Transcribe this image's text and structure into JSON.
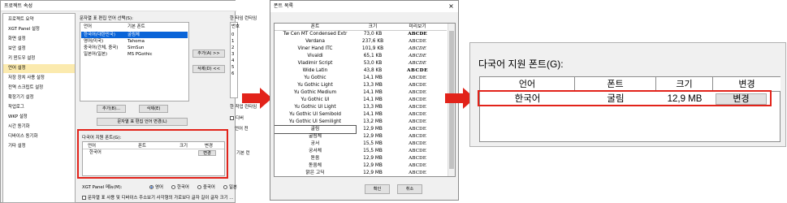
{
  "project_props": {
    "title": "프로젝트 속성",
    "nav_items": [
      {
        "label": "프로젝트 요약"
      },
      {
        "label": "XGT Panel 설정"
      },
      {
        "label": "화면 설정"
      },
      {
        "label": "보안 설정"
      },
      {
        "label": "키 윈도우 설정"
      },
      {
        "label": "언어 설정",
        "selected": true
      },
      {
        "label": "저장 장치 사용 설정"
      },
      {
        "label": "전역 스크립트 설정"
      },
      {
        "label": "확장기기 설정"
      },
      {
        "label": "작업로그"
      },
      {
        "label": "WKP 설정"
      },
      {
        "label": "시간 동기화"
      },
      {
        "label": "디바이스 동기화"
      },
      {
        "label": "기타 설정"
      }
    ],
    "lang_list_label": "문자열 표 편집 언어 선택(S):",
    "lang_columns": [
      "언어",
      "기본 폰트"
    ],
    "lang_rows": [
      {
        "lang": "한국어(대한민국)",
        "font": "굴림체",
        "selected": true
      },
      {
        "lang": "영어(미국)",
        "font": "Tahoma"
      },
      {
        "lang": "중국어(간체, 중국)",
        "font": "SimSun"
      },
      {
        "lang": "일본어(일본)",
        "font": "MS PGothic"
      }
    ],
    "add_btn": "추가(A) >>",
    "delete_btn": "삭제(D) <<",
    "add_btn2": "추가(B)...",
    "delete_btn2": "삭제(E)",
    "change_lang_btn": "문자열 표 편집 언어 변경(L)",
    "right_label1": "한 타임 런타임",
    "right_label_num": "번호",
    "right_nums": [
      "0",
      "1",
      "2",
      "3",
      "4",
      "5",
      "6"
    ],
    "right_label2": "한 작업 런타임",
    "right_chk": "디버",
    "right_label3": "언어 전",
    "right_label4": "기본 런",
    "multi_font_label": "다국어 지원 폰트(G):",
    "multi_font_columns": [
      "언어",
      "폰트",
      "크기",
      "변경"
    ],
    "multi_font_row": {
      "lang": "한국어",
      "font": "",
      "size": "",
      "change": "변경"
    },
    "panel_menu_label": "XGT Panel 메뉴(M):",
    "panel_menu_options": [
      {
        "label": "영어",
        "checked": true
      },
      {
        "label": "한국어",
        "checked": false
      },
      {
        "label": "중국어",
        "checked": false
      },
      {
        "label": "일본"
      }
    ],
    "bottom_chk": "문자열 표 사용 및 디바이스 주소보기 사각형의 가로보다 글자 길이 글자 크기 ..."
  },
  "font_list": {
    "title": "폰트 목록",
    "close": "×",
    "columns": [
      "폰트",
      "크기",
      "미리보기"
    ],
    "rows": [
      {
        "name": "Tw Cen MT Condensed Extr",
        "size": "73,0 KB",
        "preview": "ABCDE"
      },
      {
        "name": "Verdana",
        "size": "237,6 KB",
        "preview": "ABCDE"
      },
      {
        "name": "Viner Hand ITC",
        "size": "101,9 KB",
        "preview": "ABCDE"
      },
      {
        "name": "Vivaldi",
        "size": "65,1 KB",
        "preview": "ABCDE"
      },
      {
        "name": "Vladimir Script",
        "size": "53,0 KB",
        "preview": "ABCDE"
      },
      {
        "name": "Wide Latin",
        "size": "43,8 KB",
        "preview": "ABCDE"
      },
      {
        "name": "Yu Gothic",
        "size": "14,1 MB",
        "preview": "ABCDE"
      },
      {
        "name": "Yu Gothic Light",
        "size": "13,3 MB",
        "preview": "ABCDE"
      },
      {
        "name": "Yu Gothic Medium",
        "size": "14,1 MB",
        "preview": "ABCDE"
      },
      {
        "name": "Yu Gothic UI",
        "size": "14,1 MB",
        "preview": "ABCDE"
      },
      {
        "name": "Yu Gothic UI Light",
        "size": "13,3 MB",
        "preview": "ABCDE"
      },
      {
        "name": "Yu Gothic UI Semibold",
        "size": "14,1 MB",
        "preview": "ABCDE"
      },
      {
        "name": "Yu Gothic UI Semilight",
        "size": "13,2 MB",
        "preview": "ABCDE"
      },
      {
        "name": "굴림",
        "size": "12,9 MB",
        "preview": "ABCDE",
        "highlight": true
      },
      {
        "name": "굴림체",
        "size": "12,9 MB",
        "preview": "ABCDE"
      },
      {
        "name": "궁서",
        "size": "15,5 MB",
        "preview": "ABCDE"
      },
      {
        "name": "궁서체",
        "size": "15,5 MB",
        "preview": "ABCDE"
      },
      {
        "name": "돋움",
        "size": "12,9 MB",
        "preview": "ABCDE"
      },
      {
        "name": "돋움체",
        "size": "12,9 MB",
        "preview": "ABCDE"
      },
      {
        "name": "맑은 고딕",
        "size": "12,9 MB",
        "preview": "ABCDE"
      }
    ],
    "ok_btn": "확인",
    "cancel_btn": "취소"
  },
  "zoom": {
    "label": "다국어 지원 폰트(G):",
    "columns": [
      "언어",
      "폰트",
      "크기",
      "변경"
    ],
    "row": {
      "lang": "한국어",
      "font": "굴림",
      "size": "12,9 MB",
      "change": "변경"
    }
  },
  "colors": {
    "highlight_red": "#e2231a",
    "selection_blue": "#0a64d8",
    "nav_selected": "#fbeaae"
  }
}
